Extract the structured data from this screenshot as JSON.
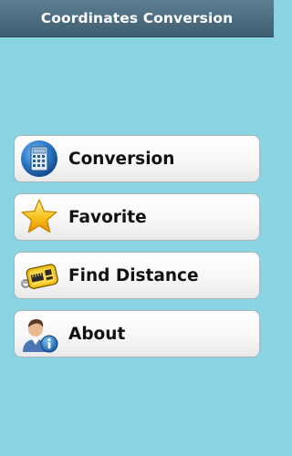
{
  "app": {
    "title": "Coordinates Conversion"
  },
  "menu": {
    "items": [
      {
        "label": "Conversion",
        "icon": "calculator-icon"
      },
      {
        "label": "Favorite",
        "icon": "star-icon"
      },
      {
        "label": "Find Distance",
        "icon": "tape-measure-icon"
      },
      {
        "label": "About",
        "icon": "user-info-icon"
      }
    ]
  },
  "colors": {
    "background": "#8ad3e3",
    "title_bar": "#4a6a7e",
    "button_border": "#a9b5bb"
  }
}
